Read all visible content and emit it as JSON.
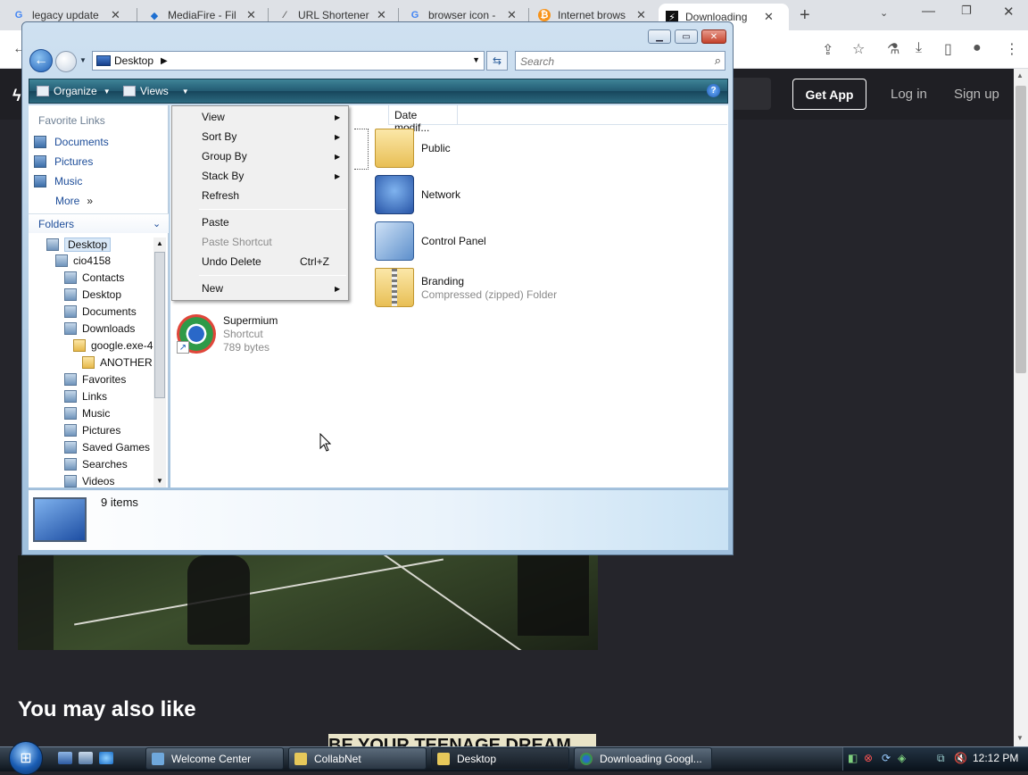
{
  "browser": {
    "tabs": [
      {
        "label": "legacy update",
        "icon": "google-icon"
      },
      {
        "label": "MediaFire - Fil",
        "icon": "mediafire-icon"
      },
      {
        "label": "URL Shortener",
        "icon": "link-icon"
      },
      {
        "label": "browser icon -",
        "icon": "google-icon"
      },
      {
        "label": "Internet brows",
        "icon": "bitcoin-icon"
      },
      {
        "label": "Downloading",
        "icon": "site-icon"
      }
    ],
    "close_glyph": "✕",
    "new_tab": "+"
  },
  "site": {
    "get_app": "Get App",
    "login": "Log in",
    "signup": "Sign up",
    "may_like": "You may also like",
    "thumb_caption": "BE YOUR TEENAGE DREAM"
  },
  "explorer": {
    "address": "Desktop",
    "search_placeholder": "Search",
    "organize": "Organize",
    "views": "Views",
    "favorite_links_title": "Favorite Links",
    "favorite_links": [
      "Documents",
      "Pictures",
      "Music",
      "More"
    ],
    "folders_title": "Folders",
    "tree": [
      "Desktop",
      "cio4158",
      "Contacts",
      "Desktop",
      "Documents",
      "Downloads",
      "google.exe-4",
      "ANOTHER",
      "Favorites",
      "Links",
      "Music",
      "Pictures",
      "Saved Games",
      "Searches",
      "Videos"
    ],
    "column_date": "Date modif...",
    "items": [
      {
        "name": "Public",
        "sub1": "",
        "sub2": ""
      },
      {
        "name": "Network",
        "sub1": "",
        "sub2": ""
      },
      {
        "name": "Control Panel",
        "sub1": "",
        "sub2": ""
      },
      {
        "name": "Branding",
        "sub1": "Compressed (zipped) Folder",
        "sub2": ""
      },
      {
        "name": "Supermium",
        "sub1": "Shortcut",
        "sub2": "789 bytes"
      }
    ],
    "item_count": "9 items"
  },
  "context_menu": {
    "view": "View",
    "sort_by": "Sort By",
    "group_by": "Group By",
    "stack_by": "Stack By",
    "refresh": "Refresh",
    "paste": "Paste",
    "paste_shortcut": "Paste Shortcut",
    "undo_delete": "Undo Delete",
    "undo_shortcut": "Ctrl+Z",
    "new": "New"
  },
  "taskbar": {
    "tasks": [
      "Welcome Center",
      "CollabNet",
      "Desktop",
      "Downloading Googl..."
    ],
    "clock": "12:12 PM"
  }
}
